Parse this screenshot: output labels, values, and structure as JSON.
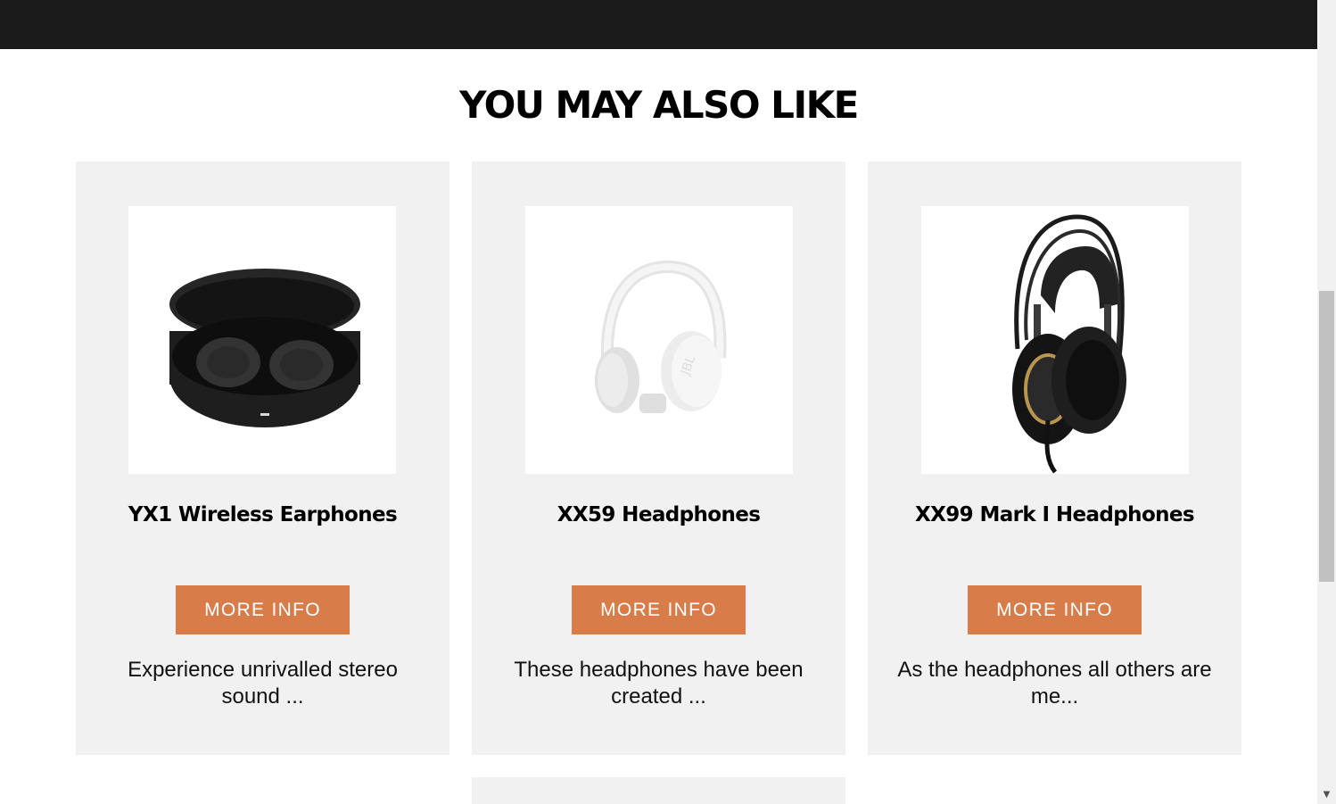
{
  "section": {
    "title": "YOU MAY ALSO LIKE"
  },
  "products": [
    {
      "name": "YX1 Wireless Earphones",
      "button": "MORE INFO",
      "description": "Experience unrivalled stereo sound ...",
      "image_icon": "earbuds-case-image"
    },
    {
      "name": "XX59 Headphones",
      "button": "MORE INFO",
      "description": "These headphones have been created ...",
      "image_icon": "white-headphones-image"
    },
    {
      "name": "XX99 Mark I Headphones",
      "button": "MORE INFO",
      "description": "As the headphones all others are me...",
      "image_icon": "black-gold-headphones-image"
    }
  ],
  "colors": {
    "accent": "#d87d4a",
    "card_bg": "#f1f1f1",
    "header_bg": "#1b1b1b"
  },
  "scrollbar": {
    "arrow_down_icon": "▼"
  }
}
